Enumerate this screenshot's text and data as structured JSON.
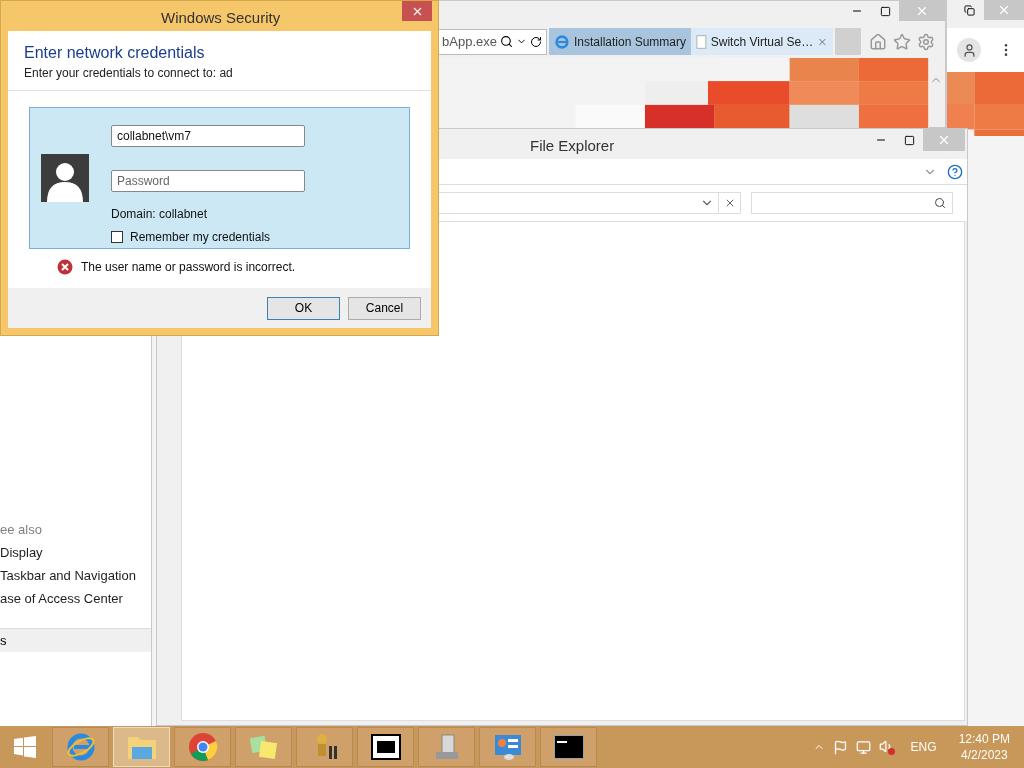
{
  "dialog": {
    "title": "Windows Security",
    "heading": "Enter network credentials",
    "subheading": "Enter your credentials to connect to: ad",
    "username": "collabnet\\vm7",
    "password_placeholder": "Password",
    "domain": "Domain: collabnet",
    "remember": {
      "label": "Remember my credentials",
      "checked": false
    },
    "error": "The user name or password is incorrect.",
    "buttons": [
      {
        "label": "OK",
        "default": true
      },
      {
        "label": "Cancel",
        "default": false
      }
    ]
  },
  "browser": {
    "address": "bApp.exe",
    "tabs": [
      {
        "label": "Installation Summary",
        "selected": false
      },
      {
        "label": "Switch Virtual Se…",
        "selected": true
      }
    ]
  },
  "explorer": {
    "title": "File Explorer"
  },
  "control_panel": {
    "heading": "ee also",
    "links": [
      "Display",
      "Taskbar and Navigation",
      "ase of Access Center"
    ],
    "footer": "s"
  },
  "taskbar": {
    "apps": [
      {
        "kind": "ie",
        "selected": false
      },
      {
        "kind": "explorer",
        "selected": true
      },
      {
        "kind": "chrome",
        "selected": false
      },
      {
        "kind": "notes",
        "selected": false
      },
      {
        "kind": "mascot",
        "selected": false
      },
      {
        "kind": "zip",
        "selected": false
      },
      {
        "kind": "server",
        "selected": false
      },
      {
        "kind": "panel",
        "selected": false
      },
      {
        "kind": "console",
        "selected": false
      }
    ],
    "language": "ENG",
    "time": "12:40 PM",
    "date": "4/2/2023"
  }
}
